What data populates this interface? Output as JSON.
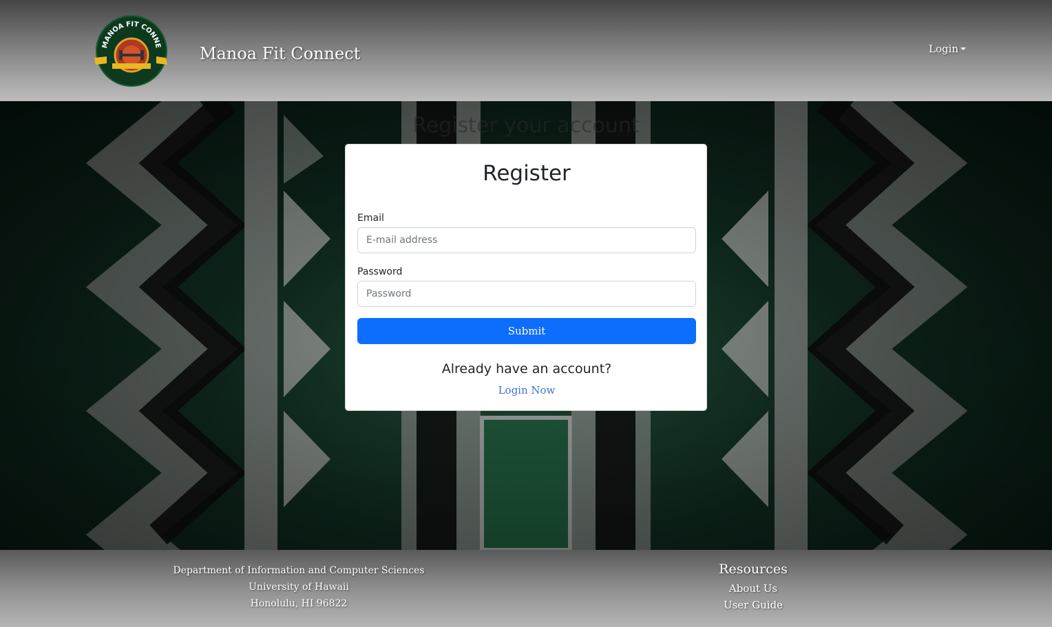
{
  "header": {
    "logo_ring_text": "MANOA FIT CONNECT",
    "brand": "Manoa Fit Connect",
    "login_menu": "Login"
  },
  "hero": {
    "title": "Register your account"
  },
  "card": {
    "title": "Register",
    "email_label": "Email",
    "email_placeholder": "E-mail address",
    "password_label": "Password",
    "password_placeholder": "Password",
    "submit_label": "Submit",
    "already_text": "Already have an account?",
    "login_link": "Login Now"
  },
  "footer": {
    "address_lines": [
      "Department of Information and Computer Sciences",
      "University of Hawaii",
      "Honolulu, HI 96822"
    ],
    "resources_title": "Resources",
    "links": [
      "About Us",
      "User Guide"
    ]
  },
  "colors": {
    "primary": "#0d6efd",
    "link": "#3d6fd6",
    "hero_green": "#1f4a36"
  }
}
